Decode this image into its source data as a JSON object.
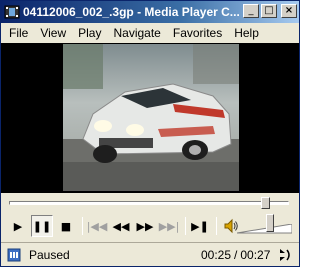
{
  "window": {
    "title": "04112006_002_.3gp - Media Player C..."
  },
  "title_buttons": {
    "minimize": "_",
    "maximize": "□",
    "close": "×"
  },
  "menu": [
    "File",
    "View",
    "Play",
    "Navigate",
    "Favorites",
    "Help"
  ],
  "seek": {
    "position_fraction": 0.93
  },
  "controls": {
    "play": "▶",
    "pause": "❚❚",
    "stop": "■",
    "prev": "|◀◀",
    "rewind": "◀◀",
    "forward": "▶▶",
    "next": "▶▶|",
    "frame_step": "▶❚"
  },
  "volume": {
    "level_fraction": 0.62
  },
  "status": {
    "state": "Paused",
    "current_time": "00:25",
    "separator": "/",
    "total_time": "00:27"
  },
  "icons": {
    "app": "media-player-icon",
    "status": "status-icon",
    "speaker": "speaker-icon",
    "stereo": "stereo-icon"
  }
}
